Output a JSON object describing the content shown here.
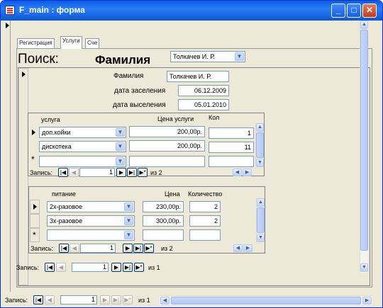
{
  "window": {
    "title": "F_main : форма",
    "minimize": "_",
    "maximize": "□",
    "close": "✕"
  },
  "tabs": [
    "Регистрация",
    "Услуги",
    "Сче"
  ],
  "search": {
    "label": "Поиск:",
    "field_label": "Фамилия",
    "value": "Толкачев И. Р."
  },
  "main": {
    "surname_label": "Фамилия",
    "surname_value": "Толкачев И. Р.",
    "checkin_label": "дата заселения",
    "checkin_value": "06.12.2009",
    "checkout_label": "дата выселения",
    "checkout_value": "05.01.2010"
  },
  "services": {
    "headers": [
      "услуга",
      "Цена услуги",
      "Кол"
    ],
    "rows": [
      {
        "name": "доп.койки",
        "price": "200,00р.",
        "qty": "1"
      },
      {
        "name": "дискотека",
        "price": "200,00р.",
        "qty": "11"
      }
    ],
    "new_row_marker": "*",
    "nav": {
      "label": "Запись:",
      "current": "1",
      "total_text": "из 2"
    }
  },
  "food": {
    "headers": [
      "питание",
      "Цена",
      "Количество"
    ],
    "rows": [
      {
        "name": "2х-разовое",
        "price": "230,00р.",
        "qty": "2"
      },
      {
        "name": "3х-разовое",
        "price": "300,00р.",
        "qty": "2"
      }
    ],
    "new_row_marker": "*",
    "nav": {
      "label": "Запись:",
      "current": "1",
      "total_text": "из 2"
    }
  },
  "form_nav": {
    "label": "Запись:",
    "current": "1",
    "total_text": "из 1"
  },
  "window_nav": {
    "label": "Запись:",
    "current": "1",
    "total_text": "из 1"
  },
  "nav_buttons": {
    "first": "|◀",
    "prev": "◀",
    "next": "▶",
    "last": "▶|",
    "new": "▶*"
  },
  "scroll": {
    "up": "▲",
    "down": "▼",
    "left": "◀",
    "right": "▶"
  },
  "colors": {
    "titlebar": "#0a5ee8",
    "form_bg": "#ece9d8"
  }
}
